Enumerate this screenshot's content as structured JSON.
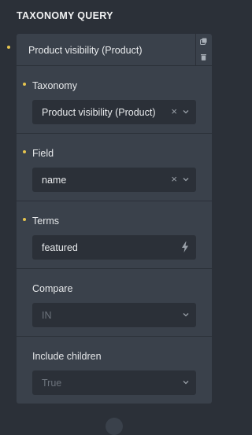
{
  "section": {
    "title": "TAXONOMY QUERY"
  },
  "panel": {
    "header_label": "Product visibility (Product)",
    "icons": {
      "copy": "copy-icon",
      "delete": "trash-icon"
    }
  },
  "groups": [
    {
      "label": "Taxonomy",
      "value": "Product visibility (Product)",
      "required": true,
      "has_clear": true,
      "control": "select",
      "clear_symbol": "×"
    },
    {
      "label": "Field",
      "value": "name",
      "required": true,
      "has_clear": true,
      "control": "select",
      "clear_symbol": "×"
    },
    {
      "label": "Terms",
      "value": "featured",
      "required": true,
      "control": "text-dynamic"
    },
    {
      "label": "Compare",
      "placeholder": "IN",
      "required": false,
      "control": "select"
    },
    {
      "label": "Include children",
      "placeholder": "True",
      "required": false,
      "control": "select"
    }
  ],
  "colors": {
    "accent_dot": "#e6c44f",
    "panel_bg": "#3a414b",
    "page_bg": "#2b3038"
  }
}
